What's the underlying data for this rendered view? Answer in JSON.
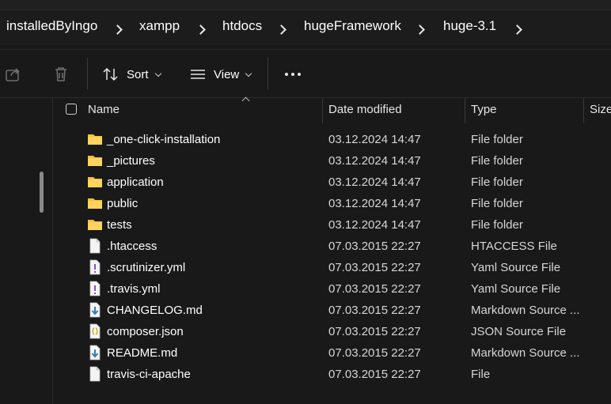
{
  "breadcrumb": [
    "installedByIngo",
    "xampp",
    "htdocs",
    "hugeFramework",
    "huge-3.1"
  ],
  "toolbar": {
    "sort_label": "Sort",
    "view_label": "View"
  },
  "columns": {
    "name": "Name",
    "date": "Date modified",
    "type": "Type",
    "size": "Size"
  },
  "files": [
    {
      "name": "_one-click-installation",
      "date": "03.12.2024 14:47",
      "type": "File folder",
      "icon": "folder-icon"
    },
    {
      "name": "_pictures",
      "date": "03.12.2024 14:47",
      "type": "File folder",
      "icon": "folder-icon"
    },
    {
      "name": "application",
      "date": "03.12.2024 14:47",
      "type": "File folder",
      "icon": "folder-icon"
    },
    {
      "name": "public",
      "date": "03.12.2024 14:47",
      "type": "File folder",
      "icon": "folder-icon"
    },
    {
      "name": "tests",
      "date": "03.12.2024 14:47",
      "type": "File folder",
      "icon": "folder-icon"
    },
    {
      "name": ".htaccess",
      "date": "07.03.2015 22:27",
      "type": "HTACCESS File",
      "icon": "file-icon"
    },
    {
      "name": ".scrutinizer.yml",
      "date": "07.03.2015 22:27",
      "type": "Yaml Source File",
      "icon": "yaml-file-icon"
    },
    {
      "name": ".travis.yml",
      "date": "07.03.2015 22:27",
      "type": "Yaml Source File",
      "icon": "yaml-file-icon"
    },
    {
      "name": "CHANGELOG.md",
      "date": "07.03.2015 22:27",
      "type": "Markdown Source ...",
      "icon": "markdown-file-icon"
    },
    {
      "name": "composer.json",
      "date": "07.03.2015 22:27",
      "type": "JSON Source File",
      "icon": "json-file-icon"
    },
    {
      "name": "README.md",
      "date": "07.03.2015 22:27",
      "type": "Markdown Source ...",
      "icon": "markdown-file-icon"
    },
    {
      "name": "travis-ci-apache",
      "date": "07.03.2015 22:27",
      "type": "File",
      "icon": "file-icon"
    }
  ]
}
